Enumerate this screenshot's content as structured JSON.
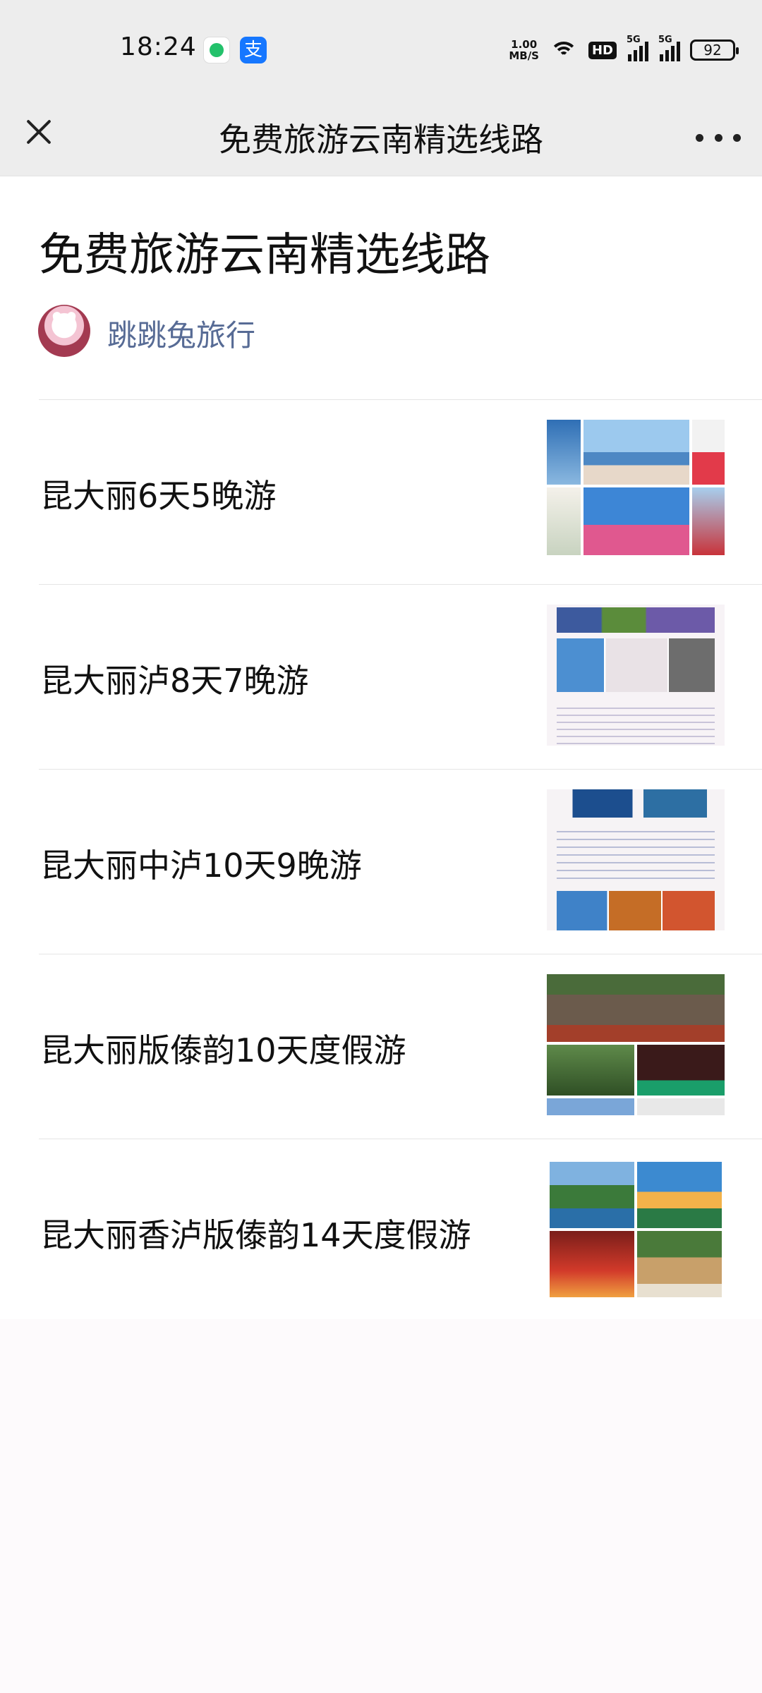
{
  "status_bar": {
    "time": "18:24",
    "net_speed_value": "1.00",
    "net_speed_unit": "MB/S",
    "hd_label": "HD",
    "sim1_label": "5G",
    "sim2_label": "5G",
    "battery": "92",
    "alipay_glyph": "支"
  },
  "navbar": {
    "title": "免费旅游云南精选线路"
  },
  "article": {
    "title": "免费旅游云南精选线路",
    "author": "跳跳兔旅行"
  },
  "routes": [
    {
      "label": "昆大丽6天5晚游"
    },
    {
      "label": "昆大丽泸8天7晚游"
    },
    {
      "label": "昆大丽中泸10天9晚游"
    },
    {
      "label": "昆大丽版傣韵10天度假游"
    },
    {
      "label": "昆大丽香泸版傣韵14天度假游"
    }
  ],
  "colors": {
    "author_link": "#576b95",
    "nav_background": "#ededed",
    "alipay_blue": "#1677ff",
    "wechat_green": "#23c16b"
  }
}
